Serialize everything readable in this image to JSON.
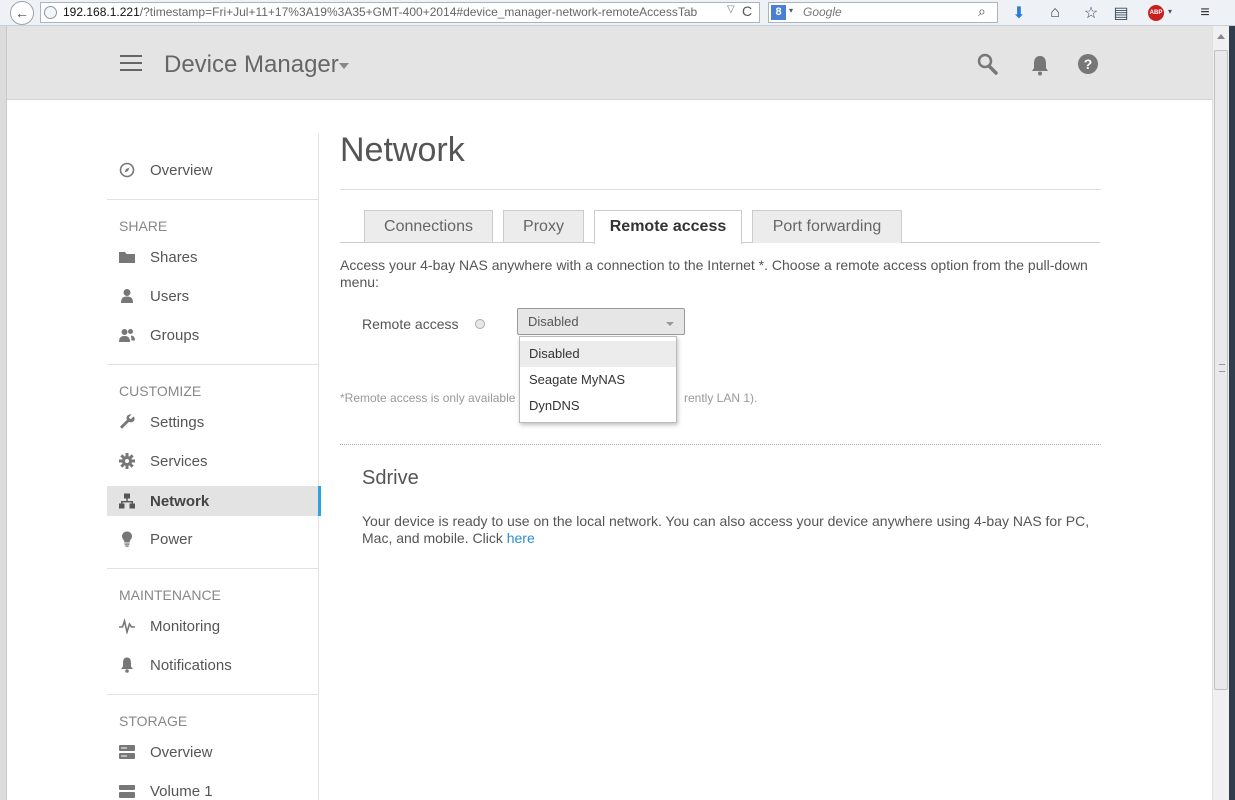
{
  "browser": {
    "back": "←",
    "url_host": "192.168.1.221",
    "url_rest": "/?timestamp=Fri+Jul+11+17%3A19%3A35+GMT-400+2014#device_manager-network-remoteAccessTab",
    "url_dropdown": "▽",
    "reload": "C",
    "search_engine_logo": "8",
    "search_engine_caret": "▾",
    "search_placeholder": "Google",
    "search_go": "⌕",
    "download": "⬇",
    "home": "⌂",
    "bookmark": "☆",
    "bookmarks_list": "▤",
    "abp": "ABP",
    "abp_caret": "▾",
    "menu": "≡"
  },
  "header": {
    "title": "Device Manager",
    "help": "?"
  },
  "sidebar": {
    "overview": "Overview",
    "sections": {
      "share": "SHARE",
      "customize": "CUSTOMIZE",
      "maintenance": "MAINTENANCE",
      "storage": "STORAGE"
    },
    "items": {
      "shares": "Shares",
      "users": "Users",
      "groups": "Groups",
      "settings": "Settings",
      "services": "Services",
      "network": "Network",
      "power": "Power",
      "monitoring": "Monitoring",
      "notifications": "Notifications",
      "storage_overview": "Overview",
      "volume1": "Volume 1"
    }
  },
  "main": {
    "title": "Network",
    "tabs": [
      "Connections",
      "Proxy",
      "Remote access",
      "Port forwarding"
    ],
    "active_tab": "Remote access",
    "intro": "Access your 4-bay NAS anywhere with a connection to the Internet *. Choose a remote access option from the pull-down menu:",
    "remote_access_label": "Remote access",
    "remote_access_value": "Disabled",
    "options": [
      "Disabled",
      "Seagate MyNAS",
      "DynDNS"
    ],
    "note_start": "*Remote access is only available",
    "note_end": "rently LAN 1).",
    "sdrive_title": "Sdrive",
    "sdrive_text": "Your device is ready to use on the local network. You can also access your device anywhere using 4-bay NAS for PC, Mac, and mobile. Click ",
    "sdrive_link": "here"
  },
  "colors": {
    "accent": "#2aa3de",
    "link": "#2a8fd2",
    "header_bg": "#e4e4e4"
  }
}
